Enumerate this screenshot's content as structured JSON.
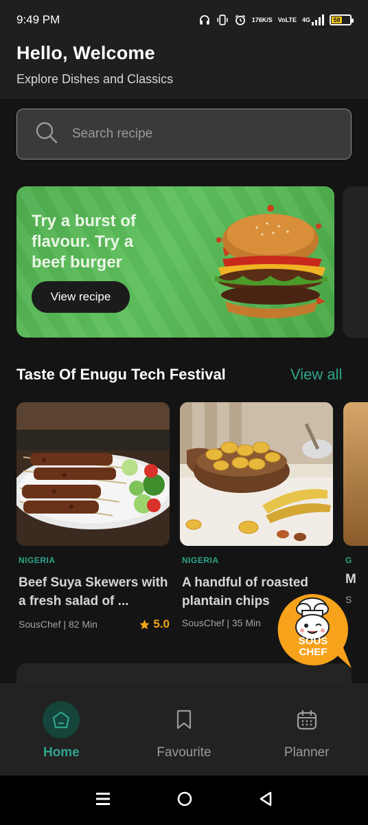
{
  "status_bar": {
    "time": "9:49 PM",
    "net_speed_value": "176",
    "net_speed_unit": "K/S",
    "volte_top": "Vo",
    "volte_bottom": "LTE",
    "network": "4G",
    "battery": "58",
    "icons": [
      "headphones-icon",
      "vibrate-icon",
      "alarm-icon",
      "signal-icon",
      "battery-icon"
    ]
  },
  "header": {
    "greeting": "Hello, Welcome",
    "subtitle": "Explore Dishes and Classics"
  },
  "search": {
    "placeholder": "Search recipe"
  },
  "banner": {
    "text": "Try a burst of flavour. Try a beef burger",
    "button": "View recipe"
  },
  "section": {
    "title": "Taste Of Enugu Tech Festival",
    "view_all": "View all"
  },
  "cards": [
    {
      "country": "NIGERIA",
      "title": "Beef Suya Skewers with a fresh salad of ...",
      "meta": "SousChef | 82 Min",
      "rating": "5.0"
    },
    {
      "country": "NIGERIA",
      "title": "A handful of roasted plantain chips",
      "meta": "SousChef | 35 Min"
    },
    {
      "country": "G",
      "title": "M",
      "meta": "S"
    }
  ],
  "chef_badge": {
    "line1": "SOUS",
    "line2": "CHEF"
  },
  "bottom_nav": {
    "items": [
      {
        "label": "Home",
        "icon": "home-icon",
        "active": true
      },
      {
        "label": "Favourite",
        "icon": "bookmark-icon",
        "active": false
      },
      {
        "label": "Planner",
        "icon": "calendar-icon",
        "active": false
      }
    ]
  },
  "colors": {
    "accent": "#2fa58a",
    "banner_green": "#5fc15d",
    "rating": "#f0a51a",
    "chef_orange": "#f7a21b"
  }
}
